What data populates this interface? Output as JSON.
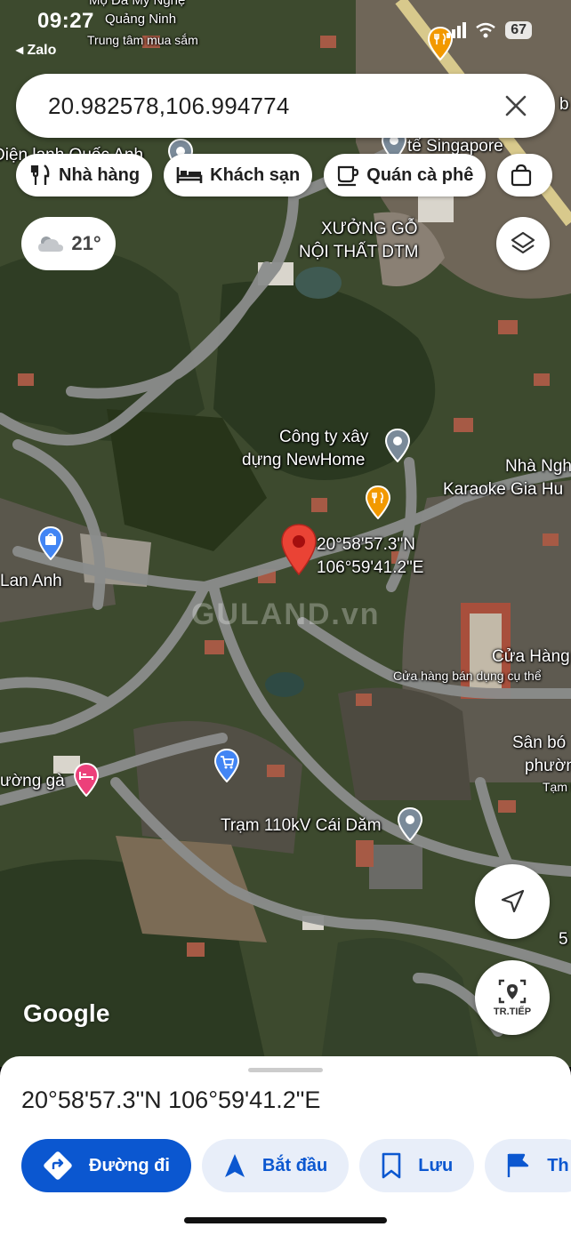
{
  "status_bar": {
    "time": "09:27",
    "back_app": "◂ Zalo",
    "battery": "67"
  },
  "search": {
    "value": "20.982578,106.994774"
  },
  "chips": [
    {
      "label": "Nhà hàng",
      "icon": "fork-knife-icon"
    },
    {
      "label": "Khách sạn",
      "icon": "bed-icon"
    },
    {
      "label": "Quán cà phê",
      "icon": "coffee-cup-icon"
    },
    {
      "label": "",
      "icon": "shopping-bag-icon"
    }
  ],
  "weather": {
    "temp": "21°"
  },
  "map": {
    "labels": {
      "top_poi": "Mộ Đá Mỹ Nghệ",
      "quang_ninh": "Quảng Ninh",
      "trung_tam": "Trung tâm mua sắm",
      "dien_lanh": "Điện lạnh Quốc Anh",
      "singapore": "tế Singapore",
      "xuong_go_1": "XƯỞNG GỖ",
      "xuong_go_2": "NỘI THẤT DTM",
      "newhome_1": "Công ty xây",
      "newhome_2": "dựng NewHome",
      "karaoke_1": "Nhà Ngh",
      "karaoke_2": "Karaoke Gia Hu",
      "pin_lat": "20°58'57.3\"N",
      "pin_lng": "106°59'41.2\"E",
      "lan_anh": "Lan Anh",
      "cua_hang_1": "Cửa Hàng",
      "cua_hang_2": "Cửa hàng bán dụng cụ thể",
      "san_bong_1": "Sân bó",
      "san_bong_2": "phường",
      "tam_thoi": "Tạm thờ",
      "duong_ga": "ường gà",
      "tram": "Trạm 110kV Cái Dăm",
      "right_num": "5",
      "right_b": "b"
    },
    "watermark": "GULAND.vn",
    "google": "Google"
  },
  "fab": {
    "live_view_caption": "TR.TIẾP"
  },
  "sheet": {
    "coords": "20°58'57.3\"N 106°59'41.2\"E",
    "actions": [
      {
        "label": "Đường đi",
        "icon": "directions-icon"
      },
      {
        "label": "Bắt đầu",
        "icon": "navigation-arrow-icon"
      },
      {
        "label": "Lưu",
        "icon": "bookmark-icon"
      },
      {
        "label": "Th",
        "icon": "flag-icon"
      }
    ]
  },
  "colors": {
    "accent": "#0b57d0",
    "pin": "#ea4335",
    "poi_blue": "#4285f4",
    "poi_orange": "#f29900",
    "poi_pink": "#ec407a",
    "poi_gray": "#7a8a99"
  }
}
